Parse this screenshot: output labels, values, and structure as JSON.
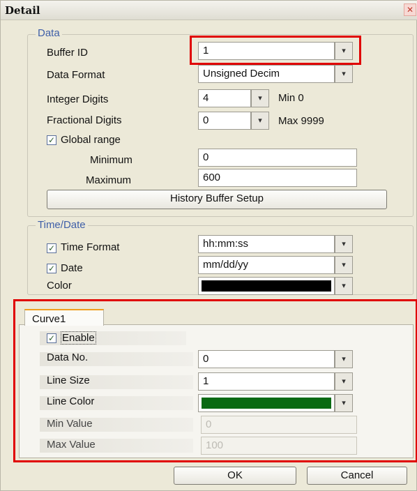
{
  "window": {
    "title": "Detail",
    "close_icon": "close-icon"
  },
  "data_group": {
    "legend": "Data",
    "buffer_id": {
      "label": "Buffer ID",
      "value": "1"
    },
    "data_format": {
      "label": "Data Format",
      "value": "Unsigned Decim"
    },
    "integer_digits": {
      "label": "Integer Digits",
      "value": "4",
      "hint": "Min 0"
    },
    "fractional_digits": {
      "label": "Fractional Digits",
      "value": "0",
      "hint": "Max 9999"
    },
    "global_range": {
      "label": "Global range",
      "checked": true
    },
    "minimum": {
      "label": "Minimum",
      "value": "0"
    },
    "maximum": {
      "label": "Maximum",
      "value": "600"
    },
    "history_button": "History Buffer Setup"
  },
  "time_group": {
    "legend": "Time/Date",
    "time_format": {
      "label": "Time Format",
      "value": "hh:mm:ss",
      "checked": true
    },
    "date": {
      "label": "Date",
      "value": "mm/dd/yy",
      "checked": true
    },
    "color": {
      "label": "Color",
      "swatch": "#000000"
    }
  },
  "curve": {
    "tab": "Curve1",
    "enable": {
      "label": "Enable",
      "checked": true
    },
    "data_no": {
      "label": "Data No.",
      "value": "0"
    },
    "line_size": {
      "label": "Line Size",
      "value": "1"
    },
    "line_color": {
      "label": "Line Color",
      "swatch": "#0a6a12"
    },
    "min_value": {
      "label": "Min Value",
      "value": "0"
    },
    "max_value": {
      "label": "Max Value",
      "value": "100"
    }
  },
  "buttons": {
    "ok": "OK",
    "cancel": "Cancel"
  },
  "colors": {
    "highlight": "#e00000",
    "legend_text": "#3f5fa8",
    "dialog_bg": "#ece9d8"
  }
}
